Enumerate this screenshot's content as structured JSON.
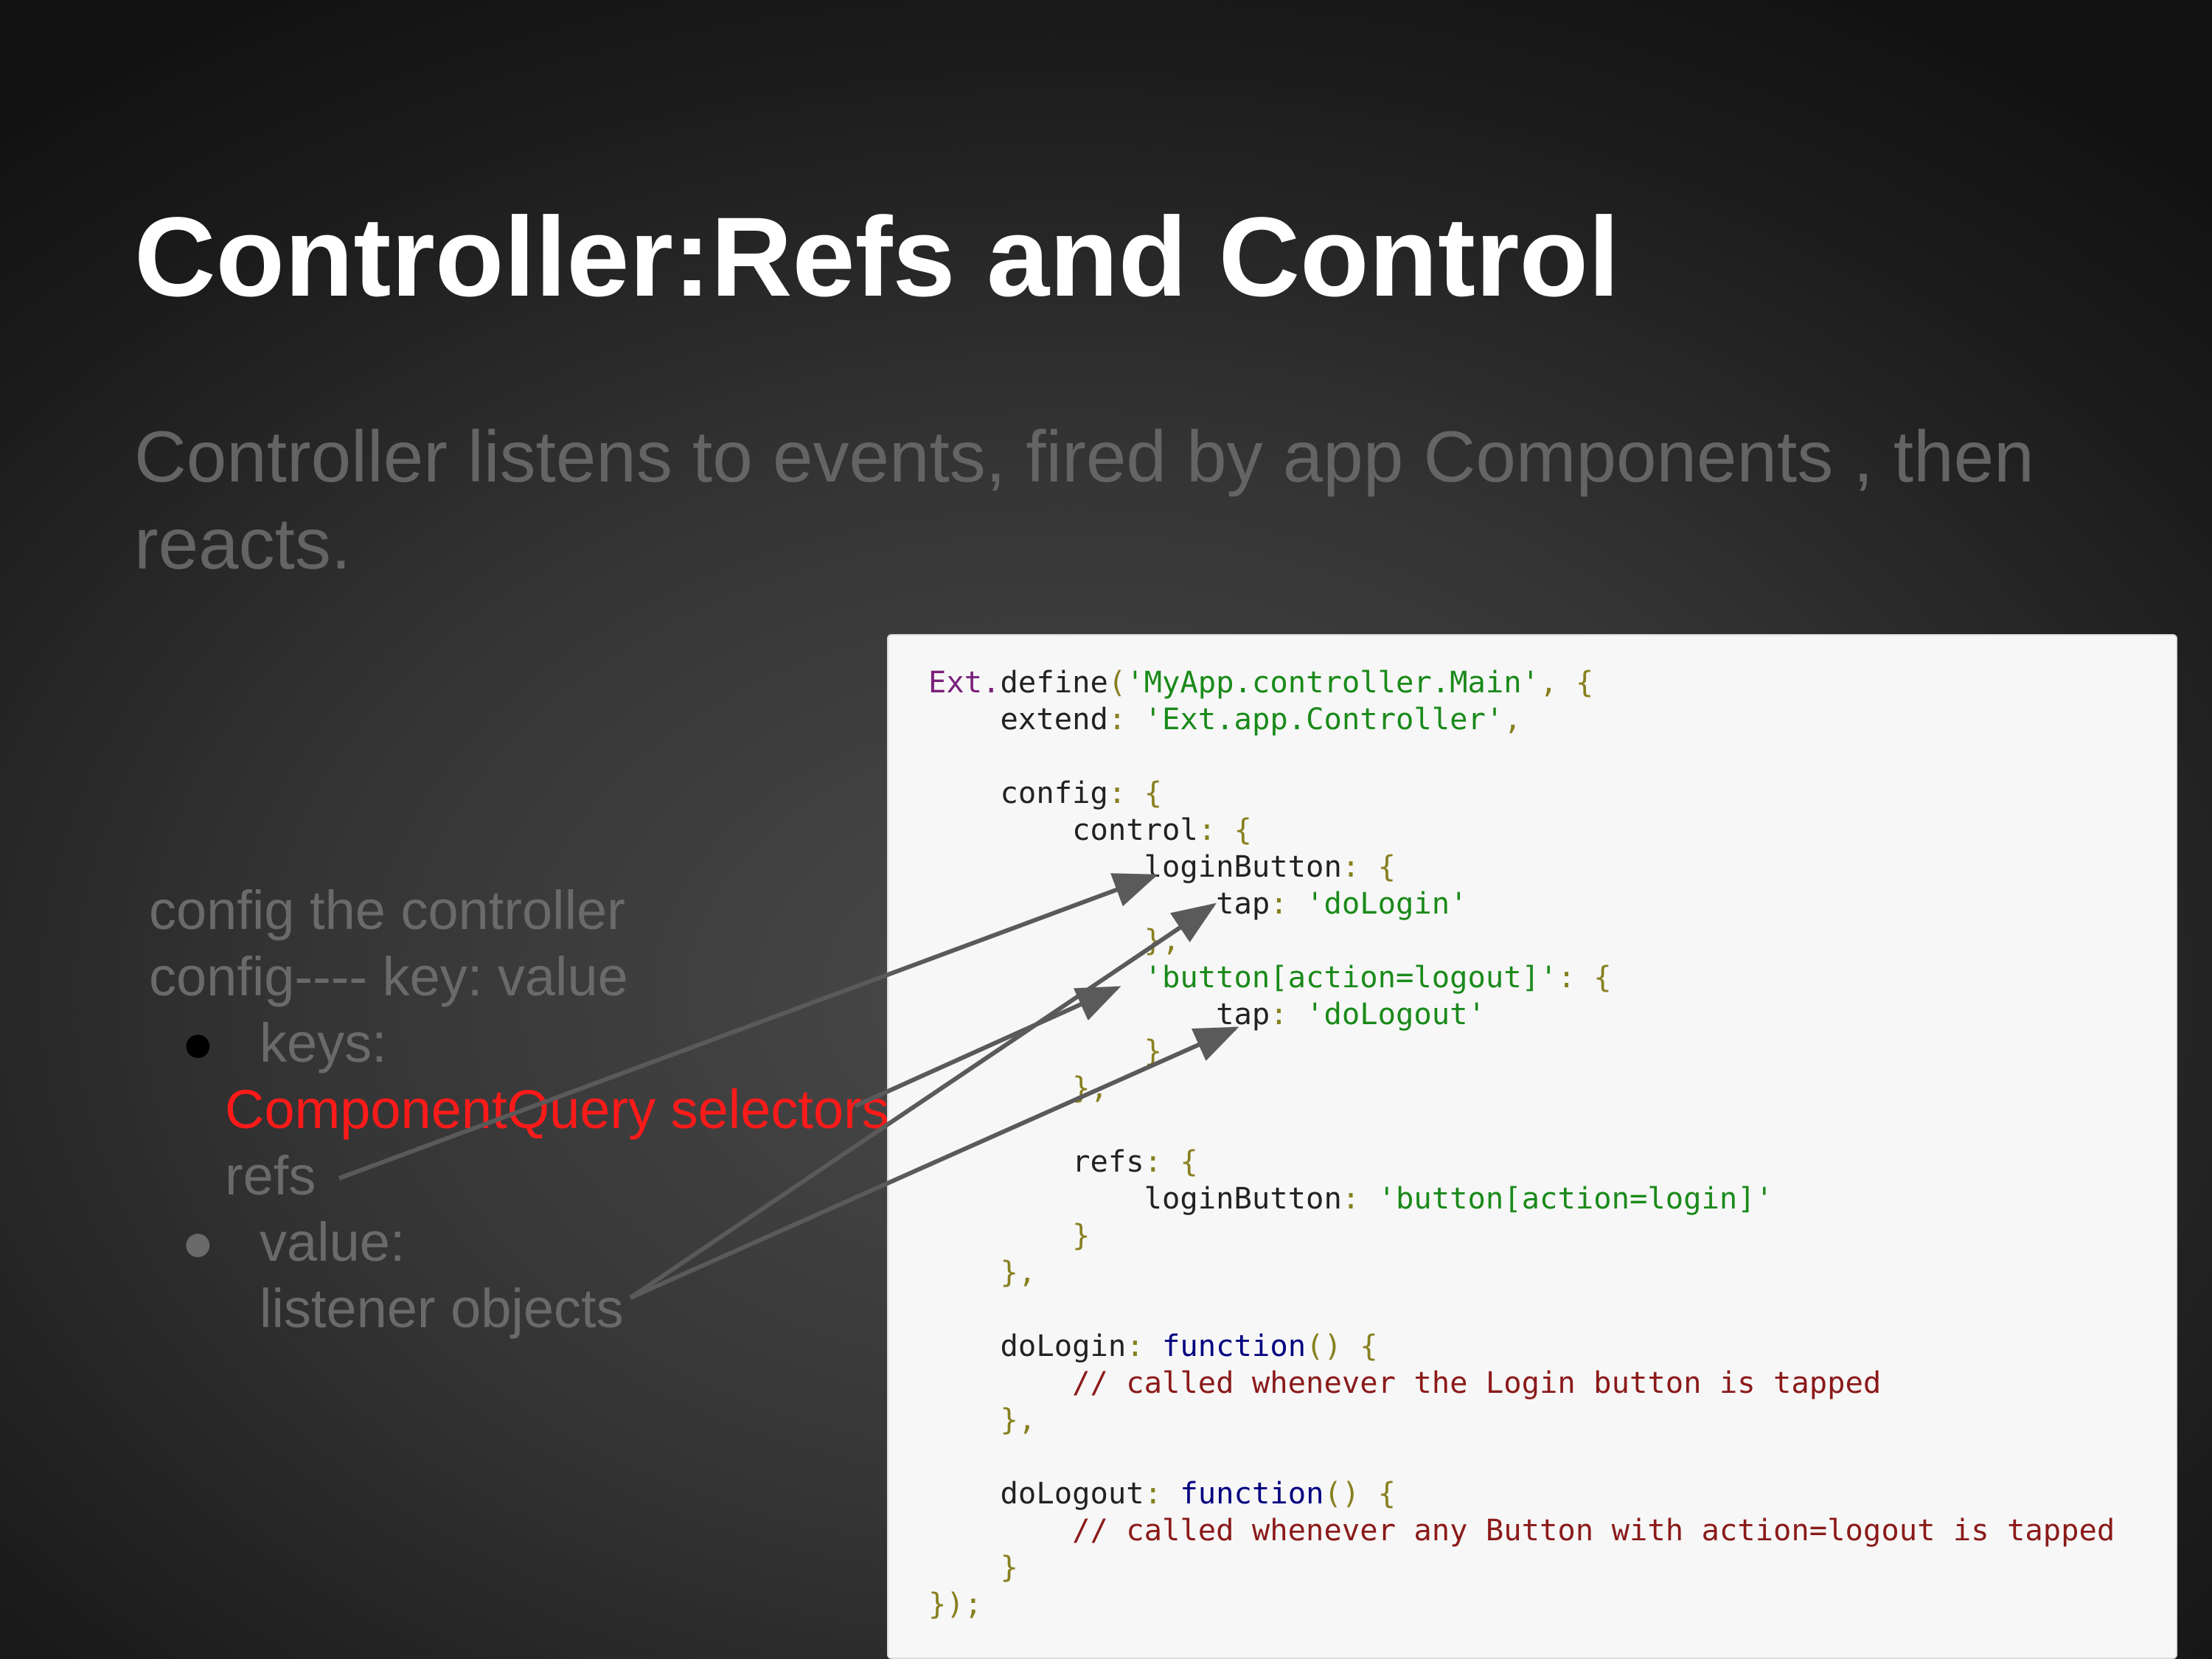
{
  "slide": {
    "title": "Controller:Refs and Control",
    "subtitle": "Controller listens to events, fired by app Components , then reacts."
  },
  "left_panel": {
    "line1": "config the controller",
    "line2": "config---- key: value",
    "bullet_marker": "●",
    "bullet1_label": "keys:",
    "bullet1_sub1": "ComponentQuery selectors",
    "bullet1_sub2": "refs",
    "bullet2_label": "value:",
    "bullet2_sub": "listener objects"
  },
  "code": {
    "l1_a": "Ext.",
    "l1_b": "define",
    "l1_c": "(",
    "l1_d": "'MyApp.controller.Main'",
    "l1_e": ", {",
    "l2_a": "extend",
    "l2_b": ": ",
    "l2_c": "'Ext.app.Controller'",
    "l2_d": ",",
    "l4_a": "config",
    "l4_b": ": {",
    "l5_a": "control",
    "l5_b": ": {",
    "l6_a": "loginButton",
    "l6_b": ": {",
    "l7_a": "tap",
    "l7_b": ": ",
    "l7_c": "'doLogin'",
    "l8": "},",
    "l9_a": "'button[action=logout]'",
    "l9_b": ": {",
    "l10_a": "tap",
    "l10_b": ": ",
    "l10_c": "'doLogout'",
    "l11": "}",
    "l12": "},",
    "l14_a": "refs",
    "l14_b": ": {",
    "l15_a": "loginButton",
    "l15_b": ": ",
    "l15_c": "'button[action=login]'",
    "l16": "}",
    "l17": "},",
    "l19_a": "doLogin",
    "l19_b": ": ",
    "l19_c": "function",
    "l19_d": "() {",
    "l20": "// called whenever the Login button is tapped",
    "l21": "},",
    "l23_a": "doLogout",
    "l23_b": ": ",
    "l23_c": "function",
    "l23_d": "() {",
    "l24": "// called whenever any Button with action=logout is tapped",
    "l25": "}",
    "l26": "});"
  }
}
